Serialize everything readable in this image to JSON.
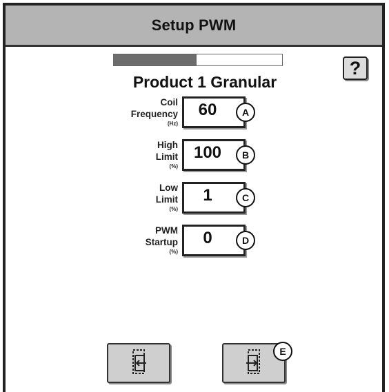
{
  "window": {
    "title": "Setup PWM"
  },
  "progress": {
    "fraction": 0.49
  },
  "help": {
    "label": "?",
    "icon": "help-icon"
  },
  "product": {
    "title": "Product 1 Granular"
  },
  "fields": [
    {
      "label_line1": "Coil",
      "label_line2": "Frequency",
      "unit": "(Hz)",
      "value": "60",
      "callout": "A"
    },
    {
      "label_line1": "High",
      "label_line2": "Limit",
      "unit": "(%)",
      "value": "100",
      "callout": "B"
    },
    {
      "label_line1": "Low",
      "label_line2": "Limit",
      "unit": "(%)",
      "value": "1",
      "callout": "C"
    },
    {
      "label_line1": "PWM",
      "label_line2": "Startup",
      "unit": "(%)",
      "value": "0",
      "callout": "D"
    }
  ],
  "navigation": {
    "back_icon": "back-page-icon",
    "next_icon": "next-page-icon",
    "next_callout": "E"
  },
  "colors": {
    "title_bar": "#b4b4b4",
    "progress_fill": "#6d6d6d",
    "button_face": "#cfcfcf"
  }
}
